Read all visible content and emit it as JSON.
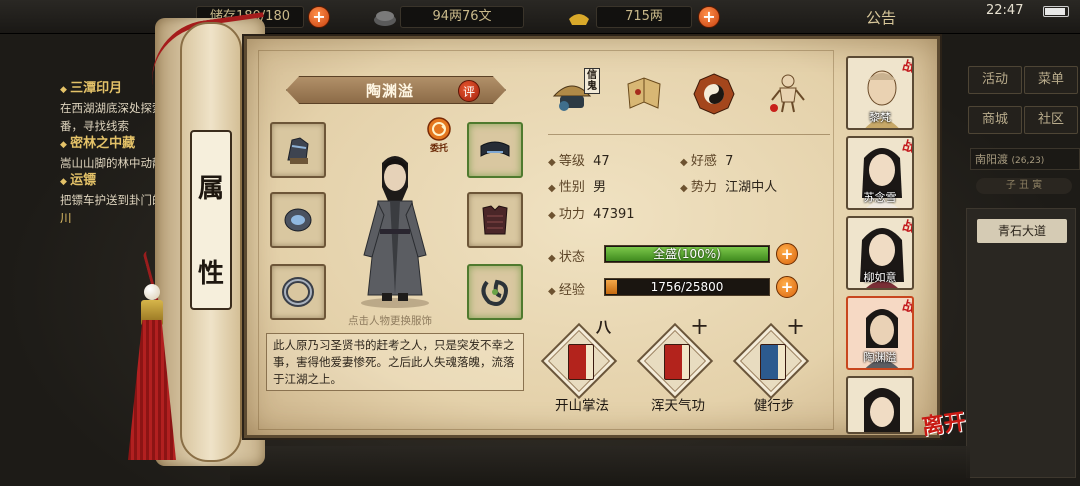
{
  "top_bar": {
    "capacity": "储存180/180",
    "money_copper": "94两76文",
    "money_gold": "715两",
    "announcement": "公告",
    "clock": "22:47"
  },
  "quests": [
    {
      "title": "三潭印月",
      "desc": "在西湖湖底深处探索一番，寻找线索"
    },
    {
      "title": "密林之中藏",
      "desc": "嵩山山脚的林中动静"
    },
    {
      "title": "运镖",
      "desc": "把镖车护送到卦门的",
      "highlight": "萧三川"
    }
  ],
  "right_menu": {
    "buttons": [
      "活动",
      "菜单",
      "商城",
      "社区"
    ],
    "location": "南阳渡",
    "location_coord": "(26,23)",
    "time": "子 丑 寅",
    "road_button": "青石大道"
  },
  "scroll": {
    "title": [
      "属",
      "性"
    ]
  },
  "character": {
    "name": "陶渊溢",
    "rate_label": "评",
    "delegate_label": "委托",
    "change_hint": "点击人物更换服饰",
    "bio": "此人原乃习圣贤书的赶考之人，只是突发不幸之事，害得他爱妻惨死。之后此人失魂落魄，流落于江湖之上。",
    "credit_tag": "信鬼"
  },
  "stats": {
    "level_label": "等级",
    "level": "47",
    "favor_label": "好感",
    "favor": "7",
    "gender_label": "性别",
    "gender": "男",
    "faction_label": "势力",
    "faction": "江湖中人",
    "power_label": "功力",
    "power": "47391"
  },
  "bars": {
    "status_label": "状态",
    "status_text": "全盛(100%)",
    "status_fraction": 1.0,
    "exp_label": "经验",
    "exp_text": "1756/25800",
    "exp_fraction": 0.068
  },
  "skills": [
    {
      "name": "开山掌法",
      "level": "八",
      "color": "#b3231c"
    },
    {
      "name": "浑天气功",
      "level": "十",
      "color": "#b3231c"
    },
    {
      "name": "健行步",
      "level": "十",
      "color": "#2c5a8e"
    }
  ],
  "party": [
    {
      "name": "黎梵",
      "fight": "战"
    },
    {
      "name": "苏念雪",
      "fight": "战"
    },
    {
      "name": "柳如意",
      "fight": "战"
    },
    {
      "name": "陶渊溢",
      "fight": "战"
    },
    {
      "name": "",
      "fight": ""
    }
  ],
  "leave_label": "离开",
  "colors": {
    "status_bar": "#5fae2e",
    "exp_bar": "#e0892a",
    "accent_red": "#c2151a"
  }
}
